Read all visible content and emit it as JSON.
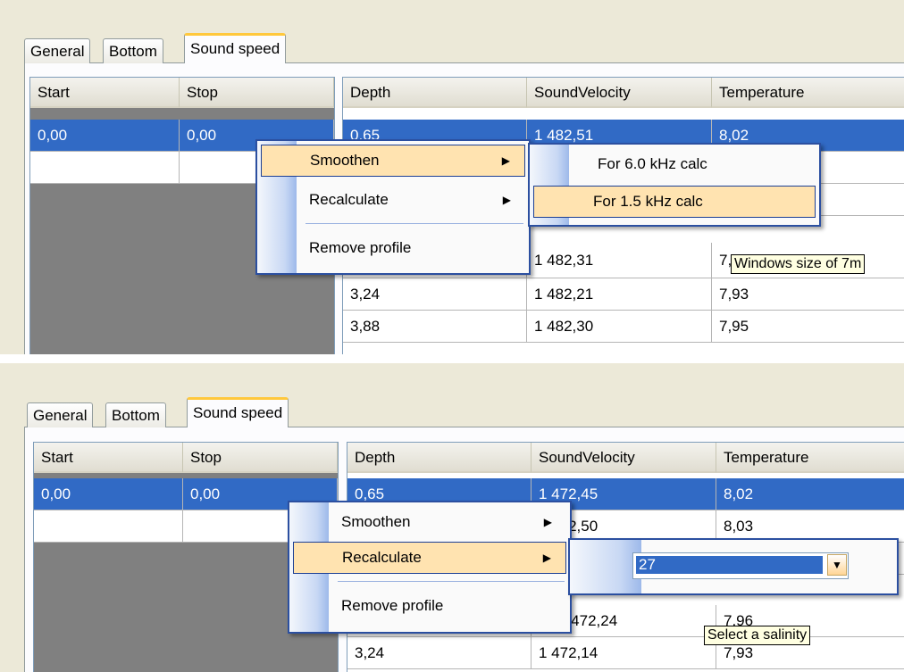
{
  "tabs": [
    "General",
    "Bottom",
    "Sound speed"
  ],
  "profile_grid": {
    "columns": [
      "Start",
      "Stop"
    ],
    "rows": [
      [
        "0,00",
        "0,00"
      ],
      [
        "",
        ""
      ]
    ]
  },
  "data_grid": {
    "columns": [
      "Depth",
      "SoundVelocity",
      "Temperature"
    ]
  },
  "top": {
    "rows": [
      [
        "0,65",
        "1 482,51",
        "8,02"
      ],
      [
        "",
        "",
        ""
      ],
      [
        "",
        "",
        ""
      ],
      [
        "",
        "1 482,31",
        "7,"
      ],
      [
        "3,24",
        "1 482,21",
        "7,93"
      ],
      [
        "3,88",
        "1 482,30",
        "7,95"
      ]
    ],
    "menu": [
      "Smoothen",
      "Recalculate",
      "Remove profile"
    ],
    "submenu": [
      "For 6.0 kHz calc",
      "For 1.5 kHz calc"
    ],
    "tooltip": "Windows size of 7m"
  },
  "bottom": {
    "rows": [
      [
        "0,65",
        "1 472,45",
        "8,02"
      ],
      [
        "",
        "1 472,50",
        "8,03"
      ],
      [
        "",
        "",
        ""
      ],
      [
        "",
        "1 472,24",
        "7,96"
      ],
      [
        "3,24",
        "1 472,14",
        "7,93"
      ]
    ],
    "menu": [
      "Smoothen",
      "Recalculate",
      "Remove profile"
    ],
    "salinity_value": "27",
    "tooltip": "Select a salinity"
  },
  "icons": {
    "submenu_arrow": "triangle-right",
    "dropdown": "triangle-down"
  },
  "colors": {
    "selection": "#316ac5",
    "menu_highlight": "#ffe3b0",
    "menu_border": "#2b4fa0",
    "active_tab_accent": "#ffc83c",
    "tooltip_bg": "#ffffe1"
  }
}
